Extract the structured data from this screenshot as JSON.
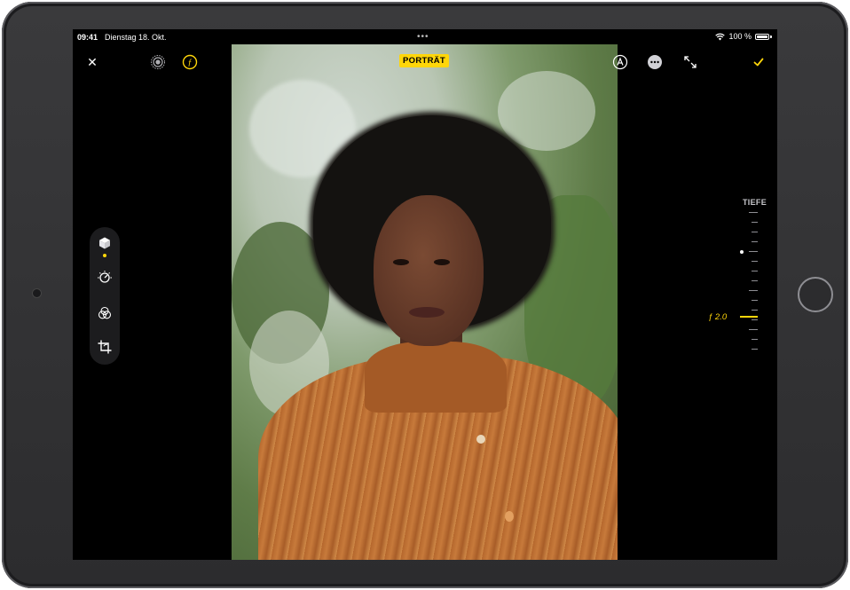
{
  "status_bar": {
    "time": "09:41",
    "date": "Dienstag 18. Okt.",
    "more_dots": "•••",
    "wifi": "wifi",
    "battery_percent": "100 %"
  },
  "top_bar": {
    "close_icon": "✕",
    "portrait_label": "PORTRÄT",
    "done_icon": "✓"
  },
  "depth": {
    "label": "TIEFE",
    "value": "ƒ 2.0"
  },
  "colors": {
    "accent": "#ffd60a",
    "screen_bg": "#000000",
    "device_frame": "#2c2c2e"
  },
  "icons": {
    "live": "live-photo-icon",
    "aperture": "aperture-icon",
    "auto": "auto-enhance-icon",
    "more": "more-icon",
    "expand": "expand-icon",
    "tools": [
      "portrait-lighting-cube-icon",
      "adjust-dial-icon",
      "filters-icon",
      "crop-icon"
    ]
  }
}
